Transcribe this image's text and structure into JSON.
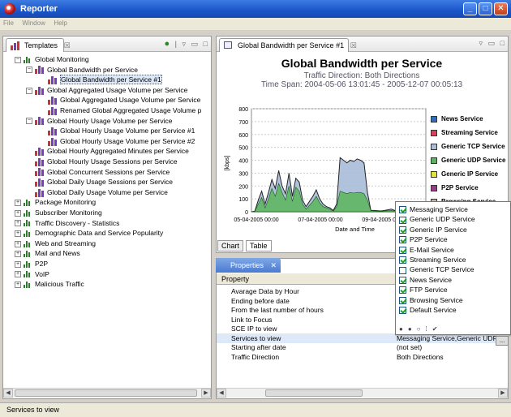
{
  "window": {
    "title": "Reporter",
    "minimize": "_",
    "maximize": "□",
    "close": "✕"
  },
  "menu": [
    "File",
    "Window",
    "Help"
  ],
  "templates_panel": {
    "tab_label": "Templates",
    "close_glyph": "☒",
    "tree": [
      {
        "label": "Global Monitoring",
        "level": 0,
        "expander": "−",
        "icon": "small"
      },
      {
        "label": "Global Bandwidth per Service",
        "level": 1,
        "expander": "−",
        "icon": "bar"
      },
      {
        "label": "Global Bandwidth per Service #1",
        "level": 2,
        "expander": "",
        "icon": "bar",
        "selected": true
      },
      {
        "label": "Global Aggregated Usage Volume per Service",
        "level": 1,
        "expander": "−",
        "icon": "bar"
      },
      {
        "label": "Global Aggregated Usage Volume per Service",
        "level": 2,
        "expander": "",
        "icon": "bar"
      },
      {
        "label": "Renamed Global Aggregated Usage Volume p",
        "level": 2,
        "expander": "",
        "icon": "bar"
      },
      {
        "label": "Global Hourly Usage Volume per Service",
        "level": 1,
        "expander": "−",
        "icon": "bar"
      },
      {
        "label": "Global Hourly Usage Volume per Service #1",
        "level": 2,
        "expander": "",
        "icon": "bar"
      },
      {
        "label": "Global Hourly Usage Volume per Service #2",
        "level": 2,
        "expander": "",
        "icon": "bar"
      },
      {
        "label": "Global Hourly Aggregated Minutes per Service",
        "level": 1,
        "expander": "",
        "icon": "bar"
      },
      {
        "label": "Global Hourly Usage Sessions per Service",
        "level": 1,
        "expander": "",
        "icon": "bar"
      },
      {
        "label": "Global Concurrent Sessions per Service",
        "level": 1,
        "expander": "",
        "icon": "bar"
      },
      {
        "label": "Global Daily Usage Sessions per Service",
        "level": 1,
        "expander": "",
        "icon": "bar"
      },
      {
        "label": "Global Daily Usage Volume per Service",
        "level": 1,
        "expander": "",
        "icon": "bar"
      },
      {
        "label": "Package Monitoring",
        "level": 0,
        "expander": "+",
        "icon": "small"
      },
      {
        "label": "Subscriber Monitoring",
        "level": 0,
        "expander": "+",
        "icon": "small"
      },
      {
        "label": "Traffic Discovery - Statistics",
        "level": 0,
        "expander": "+",
        "icon": "small"
      },
      {
        "label": "Demographic Data and Service Popularity",
        "level": 0,
        "expander": "+",
        "icon": "small"
      },
      {
        "label": "Web and Streaming",
        "level": 0,
        "expander": "+",
        "icon": "small"
      },
      {
        "label": "Mail and News",
        "level": 0,
        "expander": "+",
        "icon": "small"
      },
      {
        "label": "P2P",
        "level": 0,
        "expander": "+",
        "icon": "small"
      },
      {
        "label": "VoIP",
        "level": 0,
        "expander": "+",
        "icon": "small"
      },
      {
        "label": "Malicious Traffic",
        "level": 0,
        "expander": "+",
        "icon": "small"
      }
    ]
  },
  "report_panel": {
    "tab_label": "Global Bandwidth per Service #1",
    "close_glyph": "☒",
    "subtabs": [
      "Chart",
      "Table"
    ]
  },
  "chart_data": {
    "type": "area",
    "title": "Global Bandwidth per Service",
    "subtitle": "Traffic Direction: Both Directions",
    "timespan": "Time Span: 2004-05-06 13:01:45 - 2005-12-07 00:05:13",
    "xlabel": "Date and Time",
    "ylabel": "[kbps]",
    "ylim": [
      0,
      800
    ],
    "yticks": [
      0,
      100,
      200,
      300,
      400,
      500,
      600,
      700,
      800
    ],
    "xticks": [
      "05-04-2005 00:00",
      "07-04-2005 00:00",
      "09-04-2005 00:00"
    ],
    "grid": true,
    "legend_position": "right",
    "series": [
      {
        "name": "News Service",
        "color": "#2f6fb5"
      },
      {
        "name": "Streaming Service",
        "color": "#d9405a"
      },
      {
        "name": "Generic TCP Service",
        "color": "#a9bcd8",
        "values": [
          0,
          5,
          90,
          160,
          60,
          150,
          250,
          180,
          320,
          200,
          140,
          300,
          120,
          260,
          230,
          90,
          40,
          80,
          120,
          170,
          100,
          60,
          40,
          30,
          10,
          60,
          420,
          400,
          380,
          400,
          390,
          410,
          400,
          380,
          150,
          10,
          10,
          8,
          6,
          10,
          15,
          20,
          10,
          10,
          8
        ]
      },
      {
        "name": "Generic UDP Service",
        "color": "#5ab55a",
        "values": [
          0,
          3,
          60,
          110,
          30,
          100,
          180,
          120,
          220,
          150,
          90,
          200,
          80,
          190,
          160,
          60,
          20,
          50,
          80,
          120,
          70,
          40,
          30,
          20,
          5,
          40,
          160,
          150,
          140,
          150,
          145,
          150,
          150,
          140,
          90,
          8,
          6,
          5,
          4,
          6,
          8,
          10,
          6,
          6,
          5
        ]
      },
      {
        "name": "Generic IP Service",
        "color": "#e3e33c"
      },
      {
        "name": "P2P Service",
        "color": "#9c3a8a"
      },
      {
        "name": "Browsing Service",
        "color": "#c8b4a0"
      }
    ]
  },
  "properties_panel": {
    "tab_label": "Properties",
    "close_glyph": "✕",
    "header": "Property",
    "rows": [
      {
        "key": "Avarage Data by Hour",
        "value": ""
      },
      {
        "key": "Ending before date",
        "value": ""
      },
      {
        "key": "From the last number of hours",
        "value": ""
      },
      {
        "key": "Link to Focus",
        "value": ""
      },
      {
        "key": "SCE IP to view",
        "value": ""
      },
      {
        "key": "Services to view",
        "value": "Messaging Service,Generic UDP Se",
        "selected": true
      },
      {
        "key": "Starting after date",
        "value": "(not set)"
      },
      {
        "key": "Traffic Direction",
        "value": "Both Directions"
      }
    ],
    "ellipsis_button": "..."
  },
  "services_popup": {
    "items": [
      {
        "label": "Messaging Service",
        "checked": true
      },
      {
        "label": "Generic UDP Service",
        "checked": true
      },
      {
        "label": "Generic IP Service",
        "checked": true
      },
      {
        "label": "P2P Service",
        "checked": true
      },
      {
        "label": "E-Mail Service",
        "checked": true
      },
      {
        "label": "Streaming Service",
        "checked": true
      },
      {
        "label": "Generic TCP Service",
        "checked": false
      },
      {
        "label": "News Service",
        "checked": true
      },
      {
        "label": "FTP Service",
        "checked": true
      },
      {
        "label": "Browsing Service",
        "checked": true
      },
      {
        "label": "Default Service",
        "checked": true
      }
    ],
    "tools": [
      "●",
      "●",
      "○",
      "⁞",
      "✔"
    ]
  },
  "status": "Services to view"
}
